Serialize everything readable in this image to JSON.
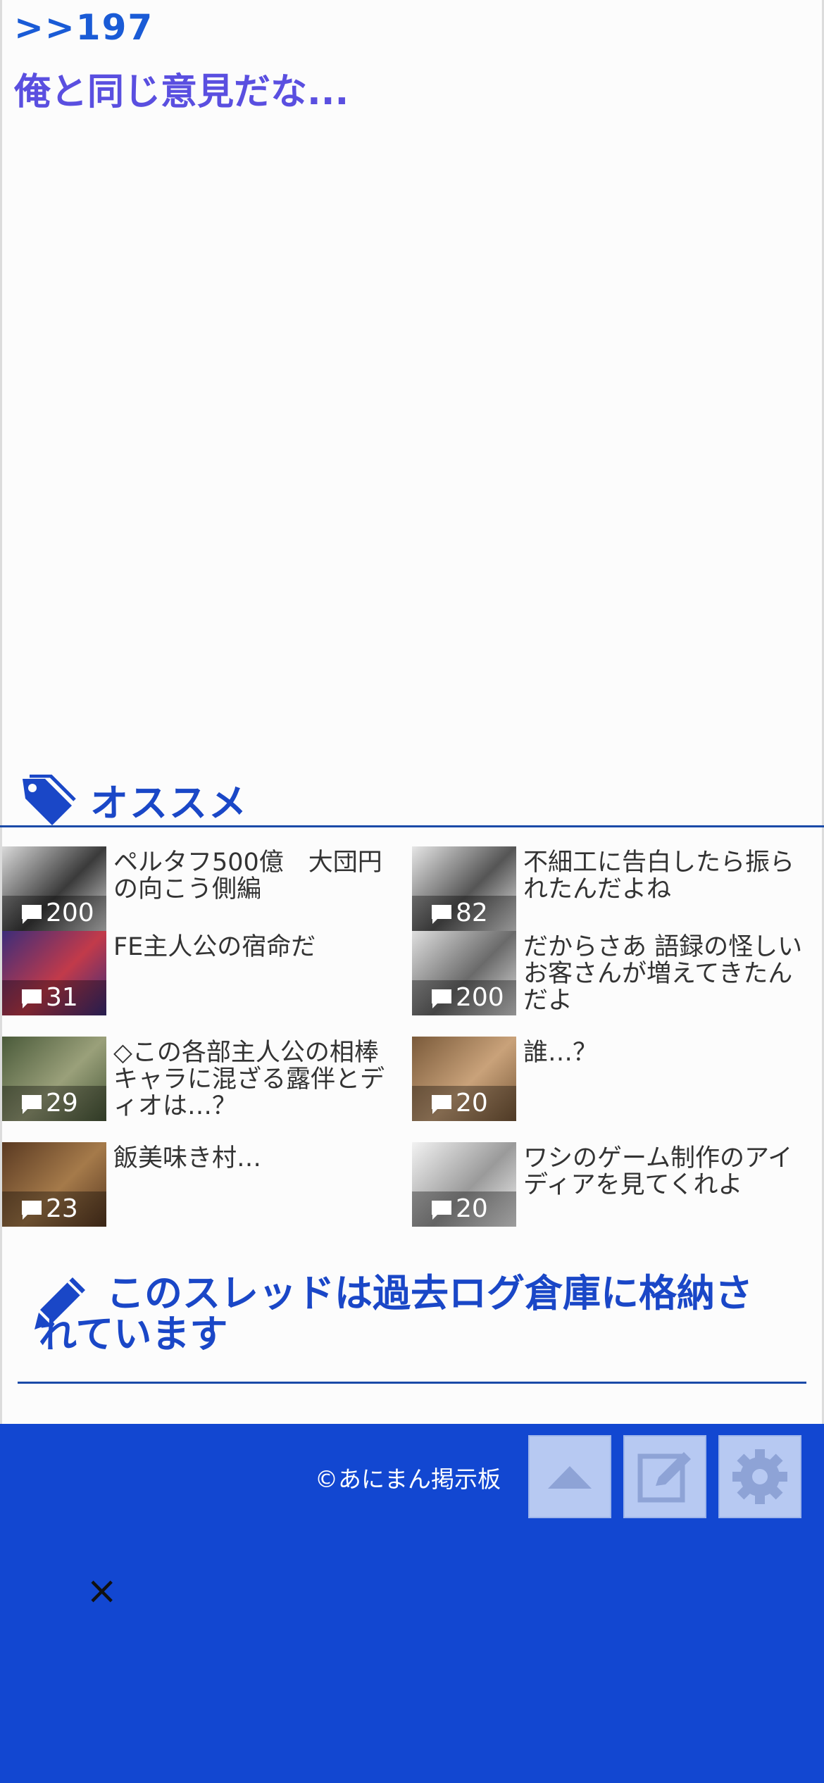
{
  "post": {
    "anchor": ">>197",
    "text": "俺と同じ意見だな..."
  },
  "recommend": {
    "title": "オススメ",
    "items": [
      {
        "title": "ペルタフ500億　大団円の向こう側編",
        "count": "200"
      },
      {
        "title": "不細工に告白したら振られたんだよね",
        "count": "82"
      },
      {
        "title": "FE主人公の宿命だ",
        "count": "31"
      },
      {
        "title": "だからさあ 語録の怪しいお客さんが増えてきたんだよ",
        "count": "200"
      },
      {
        "title": "◇この各部主人公の相棒キャラに混ざる露伴とディオは…？",
        "count": "29"
      },
      {
        "title": "誰…？",
        "count": "20"
      },
      {
        "title": "飯美味き村…",
        "count": "23"
      },
      {
        "title": "ワシのゲーム制作のアイディアを見てくれよ",
        "count": "20"
      }
    ]
  },
  "archive_notice": "このスレッドは過去ログ倉庫に格納されています",
  "footer": {
    "copyright": "©あにまん掲示板",
    "close": "×"
  },
  "icons": {
    "tag": "tag-icon",
    "pencil": "pencil-icon",
    "comment": "comment-bubble-icon",
    "up": "arrow-up-icon",
    "edit": "edit-icon",
    "settings": "gear-icon"
  },
  "colors": {
    "accent": "#1a47c7",
    "footer": "#1247d1",
    "link": "#1a5bd6",
    "comment": "#5a4fe0"
  }
}
